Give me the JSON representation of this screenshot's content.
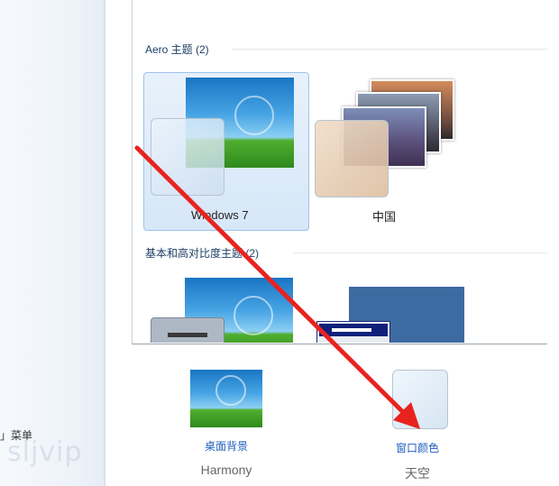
{
  "sidebar": {
    "menu_text": "」菜单",
    "watermark": "sljvip"
  },
  "aero_group": {
    "title": "Aero 主题 (2)",
    "themes": [
      {
        "name": "Windows 7",
        "selected": true
      },
      {
        "name": "中国",
        "selected": false
      }
    ]
  },
  "basic_group": {
    "title": "基本和高对比度主题 (2)"
  },
  "bottom": {
    "background": {
      "link": "桌面背景",
      "value": "Harmony"
    },
    "window_color": {
      "link": "窗口颜色",
      "value": "天空"
    }
  },
  "colors": {
    "arrow": "#e8231f",
    "link": "#1f5fbf",
    "selection": "#d6e7f8"
  }
}
